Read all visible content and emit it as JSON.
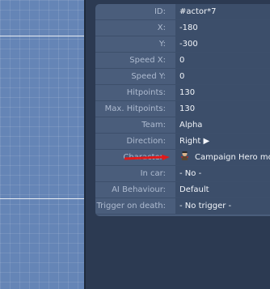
{
  "properties": [
    {
      "key": "id",
      "label": "ID:",
      "value": "#actor*7"
    },
    {
      "key": "x",
      "label": "X:",
      "value": "-180"
    },
    {
      "key": "y",
      "label": "Y:",
      "value": "-300"
    },
    {
      "key": "speed-x",
      "label": "Speed X:",
      "value": "0"
    },
    {
      "key": "speed-y",
      "label": "Speed Y:",
      "value": "0"
    },
    {
      "key": "hitpoints",
      "label": "Hitpoints:",
      "value": "130"
    },
    {
      "key": "max-hitpoints",
      "label": "Max. Hitpoints:",
      "value": "130"
    },
    {
      "key": "team",
      "label": "Team:",
      "value": "Alpha"
    },
    {
      "key": "direction",
      "label": "Direction:",
      "value": "Right ▶"
    },
    {
      "key": "character",
      "label": "Character:",
      "value": "Campaign Hero mode"
    },
    {
      "key": "in-car",
      "label": "In car:",
      "value": "- No -"
    },
    {
      "key": "ai-behaviour",
      "label": "AI Behaviour:",
      "value": "Default"
    },
    {
      "key": "trigger-on-death",
      "label": "Trigger on death:",
      "value": "- No trigger -"
    }
  ],
  "colors": {
    "canvas": "#6585b6",
    "panel": "#4a5d7b",
    "value_bg": "#3c4e6a",
    "arrow": "#e01a1a"
  },
  "icons": {
    "character": "character-avatar-icon"
  }
}
